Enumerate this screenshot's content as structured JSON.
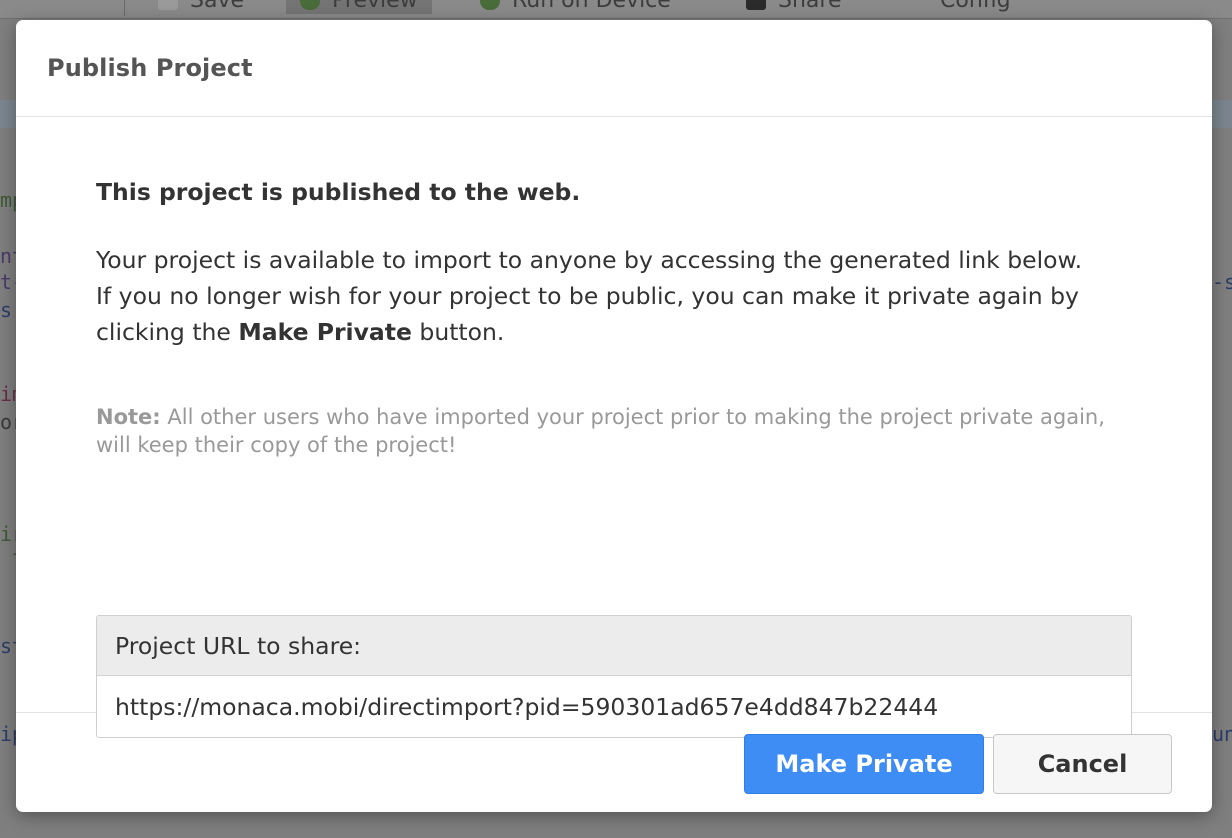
{
  "background": {
    "toolbar_items": [
      {
        "label": "Save",
        "icon": "save-icon",
        "color": "#9a9a9a"
      },
      {
        "label": "Preview",
        "icon": "preview-icon",
        "color": "#4a6b3a"
      },
      {
        "label": "Run on Device",
        "icon": "run-icon",
        "color": "#4a6b3a"
      },
      {
        "label": "Share",
        "icon": "share-icon",
        "color": "#2b2b2b"
      },
      {
        "label": "Config",
        "icon": "gear-icon",
        "color": "#8a8a8a"
      }
    ]
  },
  "dialog": {
    "title": "Publish Project",
    "heading": "This project is published to the web.",
    "para_line1": "Your project is available to import to anyone by accessing the generated link below.",
    "para_line2_before": "If you no longer wish for your project to be public, you can make it private again by clicking the ",
    "para_line2_bold": "Make Private",
    "para_line2_after": " button.",
    "note_label": "Note:",
    "note_text": " All other users who have imported your project prior to making the project private again, will keep their copy of the project!",
    "url_panel_label": "Project URL to share:",
    "url_value": "https://monaca.mobi/directimport?pid=590301ad657e4dd847b22444",
    "make_private_label": "Make Private",
    "cancel_label": "Cancel"
  },
  "colors": {
    "primary_button": "#3d8df5",
    "overlay": "#7f7f7f"
  }
}
